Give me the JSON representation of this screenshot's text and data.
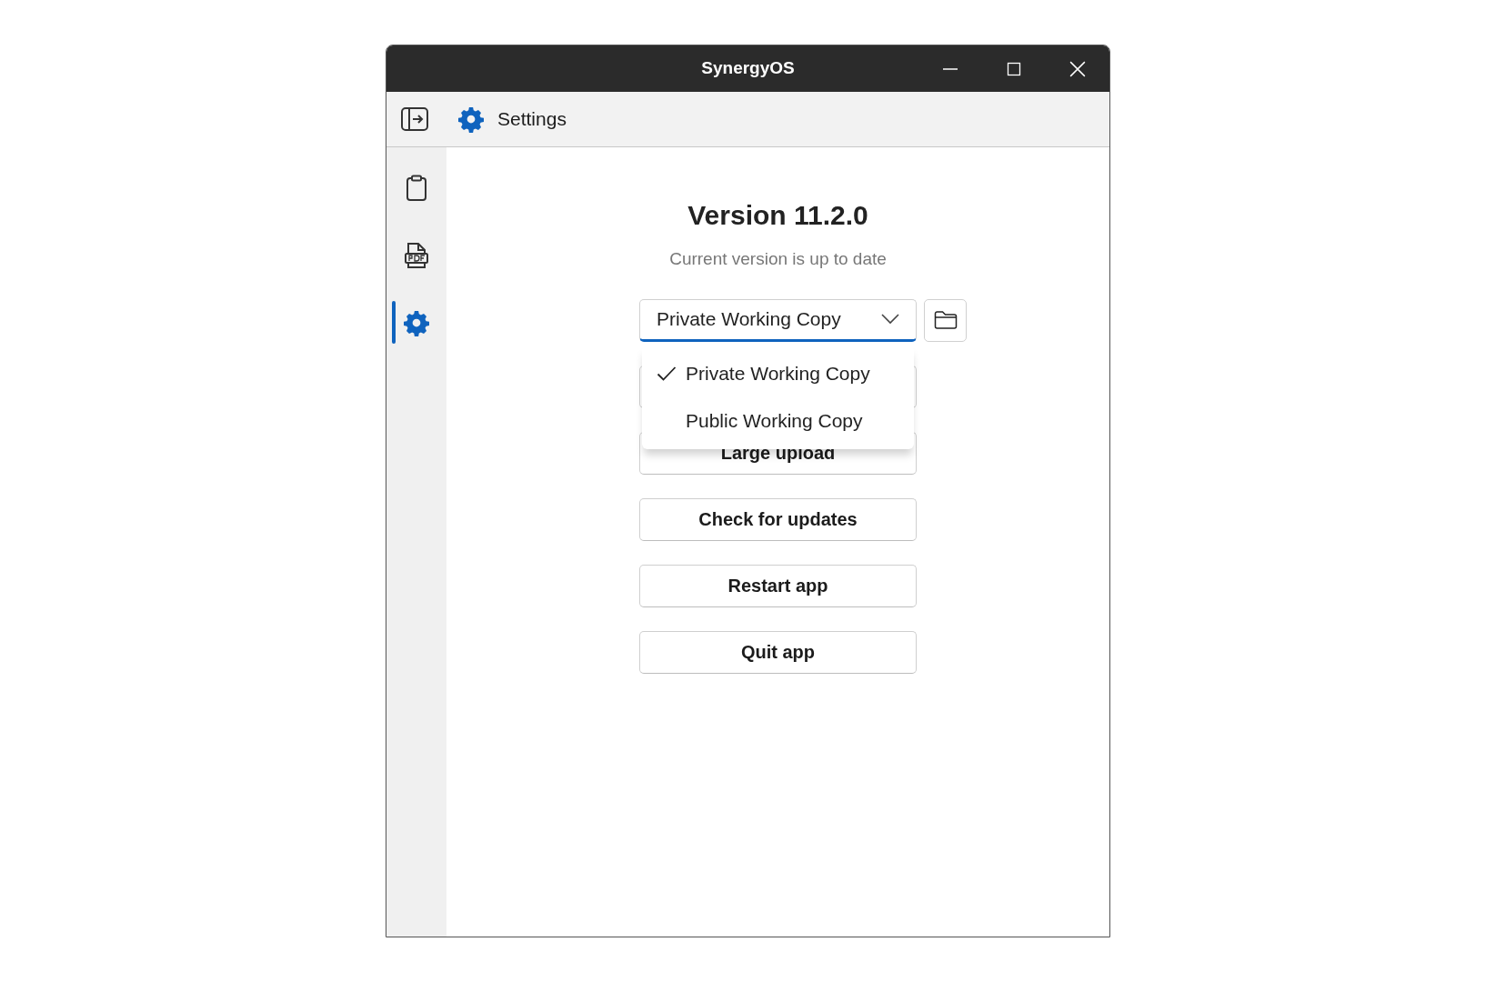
{
  "window": {
    "title": "SynergyOS"
  },
  "header": {
    "title": "Settings"
  },
  "sidebar": {
    "items": [
      {
        "kind": "clipboard",
        "selected": false
      },
      {
        "kind": "pdf",
        "selected": false
      },
      {
        "kind": "settings",
        "selected": true
      }
    ]
  },
  "content": {
    "version": "Version 11.2.0",
    "status": "Current version is up to date",
    "dropdown": {
      "value": "Private Working Copy",
      "expanded": true,
      "options": [
        {
          "label": "Private Working Copy",
          "selected": true
        },
        {
          "label": "Public Working Copy",
          "selected": false
        }
      ]
    },
    "buttons": [
      {
        "kind": "covered"
      },
      {
        "kind": "button",
        "label": "Large upload"
      },
      {
        "kind": "button",
        "label": "Check for updates"
      },
      {
        "kind": "button",
        "label": "Restart app"
      },
      {
        "kind": "button",
        "label": "Quit app"
      }
    ]
  }
}
